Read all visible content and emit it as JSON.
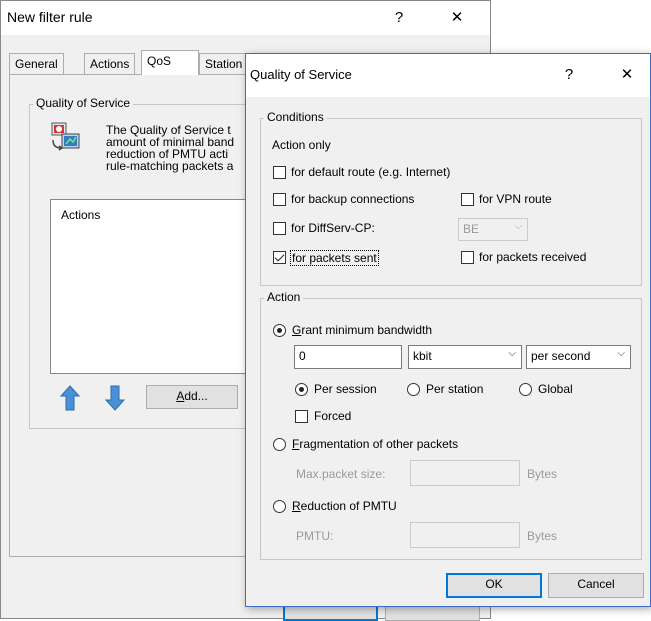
{
  "background_window": {
    "title": "New filter rule",
    "help_glyph": "?",
    "close_glyph": "✕",
    "tabs": [
      {
        "label": "General"
      },
      {
        "label": "Actions"
      },
      {
        "label": "QoS"
      },
      {
        "label": "Station"
      }
    ],
    "group_title": "Quality of Service",
    "description_lines": [
      "The Quality of Service t",
      "amount of minimal band",
      "reduction of PMTU acti",
      "rule-matching packets a"
    ],
    "actions_list_header": "Actions",
    "add_button": {
      "label": "Add...",
      "mnemonic": "A",
      "rest": "dd..."
    }
  },
  "dialog": {
    "title": "Quality of Service",
    "help_glyph": "?",
    "close_glyph": "✕",
    "conditions": {
      "legend": "Conditions",
      "action_only_label": "Action only",
      "default_route": {
        "label": "for default route (e.g. Internet)",
        "checked": false
      },
      "backup_connections": {
        "label": "for backup connections",
        "checked": false
      },
      "vpn_route": {
        "label": "for VPN route",
        "checked": false
      },
      "diffserv": {
        "label": "for DiffServ-CP:",
        "checked": false,
        "value": "BE"
      },
      "packets_sent": {
        "label": "for packets sent",
        "checked": true
      },
      "packets_received": {
        "label": "for packets received",
        "checked": false
      }
    },
    "action": {
      "legend": "Action",
      "grant_bandwidth": {
        "mnemonic": "G",
        "rest": "rant minimum bandwidth",
        "selected": true
      },
      "bandwidth_value": "0",
      "unit_value": "kbit",
      "period_value": "per second",
      "per_session": {
        "label": "Per session",
        "selected": true
      },
      "per_station": {
        "label": "Per station",
        "selected": false
      },
      "global": {
        "label": "Global",
        "selected": false
      },
      "forced": {
        "label": "Forced",
        "checked": false
      },
      "fragmentation": {
        "mnemonic": "F",
        "rest": "ragmentation of other packets",
        "selected": false
      },
      "max_packet_size_label": "Max.packet size:",
      "max_packet_size_value": "",
      "bytes_label_1": "Bytes",
      "reduction_pmtu": {
        "mnemonic": "R",
        "rest": "eduction of PMTU",
        "selected": false
      },
      "pmtu_label": "PMTU:",
      "pmtu_value": "",
      "bytes_label_2": "Bytes"
    },
    "ok_button": "OK",
    "cancel_button": "Cancel"
  },
  "colors": {
    "window_bg": "#f0f0f0",
    "dialog_border": "#3c6ec8",
    "default_button_border": "#0078d7",
    "disabled_text": "#9a9a9a",
    "arrow_icon_blue": "#4a90d9"
  },
  "icons": [
    "qos-icon",
    "arrow-up-icon",
    "arrow-down-icon",
    "help-icon",
    "close-icon",
    "chevron-down-icon"
  ]
}
